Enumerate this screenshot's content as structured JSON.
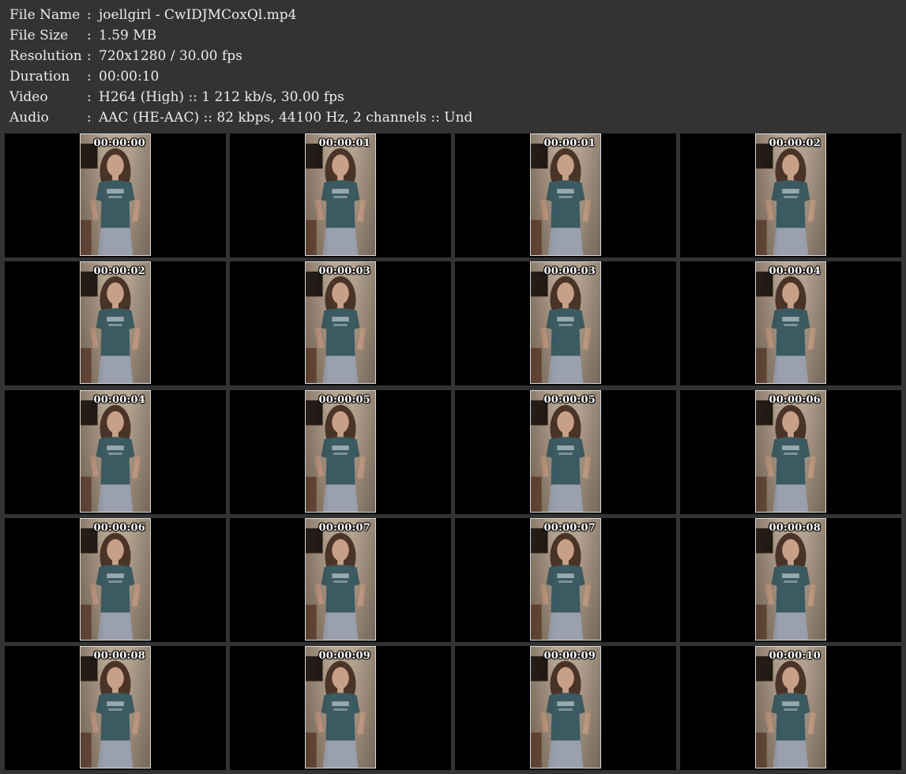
{
  "info": [
    {
      "label": "File Name",
      "value": "joellgirl - CwIDJMCoxQl.mp4"
    },
    {
      "label": "File Size",
      "value": "1.59 MB"
    },
    {
      "label": "Resolution",
      "value": "720x1280 / 30.00 fps"
    },
    {
      "label": "Duration",
      "value": "00:00:10"
    },
    {
      "label": "Video",
      "value": "H264 (High) :: 1 212 kb/s, 30.00 fps"
    },
    {
      "label": "Audio",
      "value": "AAC (HE-AAC) :: 82 kbps, 44100 Hz, 2 channels :: Und"
    }
  ],
  "separator": ":",
  "thumbnails": [
    "00:00:00",
    "00:00:01",
    "00:00:01",
    "00:00:02",
    "00:00:02",
    "00:00:03",
    "00:00:03",
    "00:00:04",
    "00:00:04",
    "00:00:05",
    "00:00:05",
    "00:00:06",
    "00:00:06",
    "00:00:07",
    "00:00:07",
    "00:00:08",
    "00:00:08",
    "00:00:09",
    "00:00:09",
    "00:00:10"
  ],
  "colors": {
    "background": "#333333",
    "info_text": "#ececec",
    "cell_background": "#000000",
    "timestamp_text": "#ffffff",
    "shirt": "#3b5a62",
    "hair": "#4a3428",
    "skin": "#c8a088",
    "pants": "#9aa0ad"
  }
}
